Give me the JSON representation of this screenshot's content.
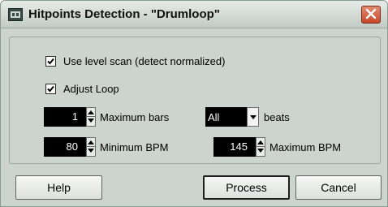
{
  "window": {
    "title": "Hitpoints Detection - \"Drumloop\"",
    "close_icon": "close-icon",
    "app_icon": "cubase-window-icon"
  },
  "options": {
    "level_scan": {
      "label": "Use level scan (detect normalized)",
      "checked": true
    },
    "adjust_loop": {
      "label": "Adjust Loop",
      "checked": true
    }
  },
  "fields": {
    "max_bars": {
      "value": "1",
      "label": "Maximum bars"
    },
    "beats": {
      "value": "All",
      "label": "beats"
    },
    "min_bpm": {
      "value": "80",
      "label": "Minimum BPM"
    },
    "max_bpm": {
      "value": "145",
      "label": "Maximum BPM"
    }
  },
  "buttons": {
    "help": "Help",
    "process": "Process",
    "cancel": "Cancel"
  },
  "colors": {
    "dialog_bg": "#cdd3cf",
    "field_bg": "#000000",
    "close_red": "#c8482a"
  }
}
